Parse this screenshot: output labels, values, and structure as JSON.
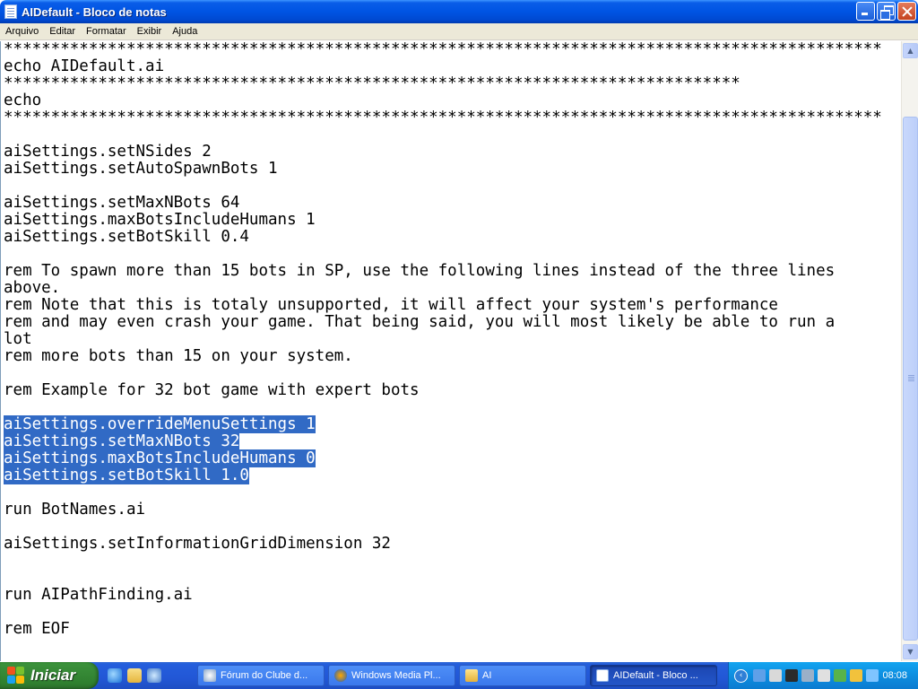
{
  "window": {
    "title": "AIDefault - Bloco de notas"
  },
  "menu": {
    "items": [
      "Arquivo",
      "Editar",
      "Formatar",
      "Exibir",
      "Ajuda"
    ]
  },
  "editor": {
    "lines": [
      "*********************************************************************************************",
      "echo AIDefault.ai",
      "******************************************************************************",
      "echo",
      "*********************************************************************************************",
      "",
      "aiSettings.setNSides 2",
      "aiSettings.setAutoSpawnBots 1",
      "",
      "aiSettings.setMaxNBots 64",
      "aiSettings.maxBotsIncludeHumans 1",
      "aiSettings.setBotSkill 0.4",
      "",
      "rem To spawn more than 15 bots in SP, use the following lines instead of the three lines",
      "above.",
      "rem Note that this is totaly unsupported, it will affect your system's performance",
      "rem and may even crash your game. That being said, you will most likely be able to run a",
      "lot",
      "rem more bots than 15 on your system.",
      "",
      "rem Example for 32 bot game with expert bots",
      "",
      "aiSettings.overrideMenuSettings 1",
      "aiSettings.setMaxNBots 32",
      "aiSettings.maxBotsIncludeHumans 0",
      "aiSettings.setBotSkill 1.0",
      "",
      "run BotNames.ai",
      "",
      "aiSettings.setInformationGridDimension 32",
      "",
      "",
      "run AIPathFinding.ai",
      "",
      "rem EOF"
    ],
    "selected_line_indices": [
      22,
      23,
      24,
      25
    ]
  },
  "taskbar": {
    "start_label": "Iniciar",
    "buttons": [
      {
        "label": "Fórum do Clube d...",
        "icon": "browser-icon",
        "active": false
      },
      {
        "label": "Windows Media Pl...",
        "icon": "media-player-icon",
        "active": false
      },
      {
        "label": "AI",
        "icon": "folder-icon",
        "active": false
      },
      {
        "label": "AIDefault - Bloco ...",
        "icon": "notepad-icon",
        "active": true
      }
    ],
    "clock": "08:08"
  },
  "colors": {
    "selection": "#316ac5",
    "titlebar": "#0054e3",
    "taskbar": "#245edc"
  }
}
